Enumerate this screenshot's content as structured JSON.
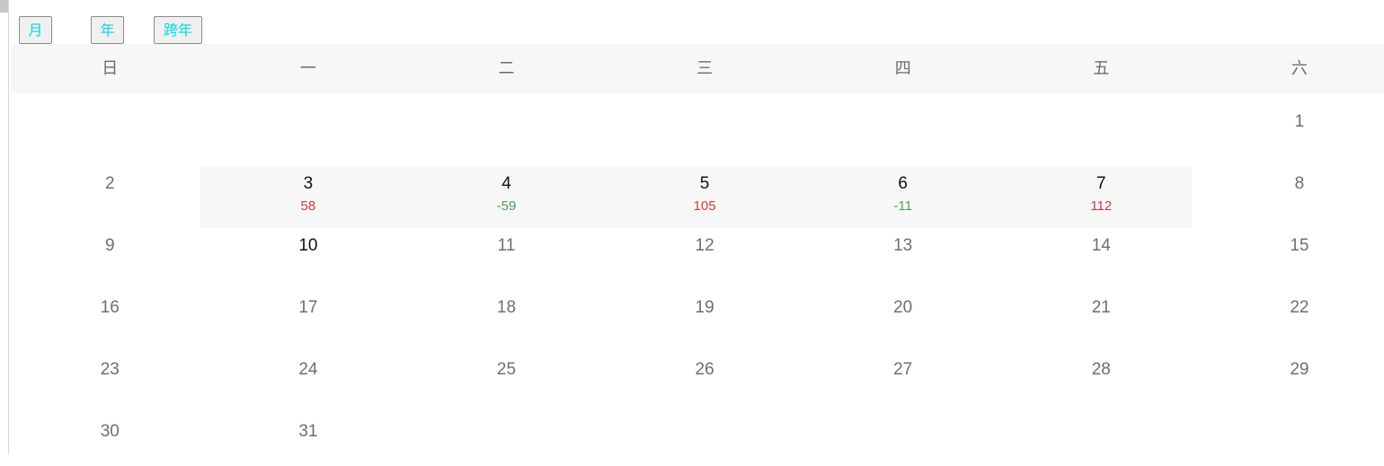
{
  "toolbar": {
    "month_label": "月",
    "year_label": "年",
    "cross_year_label": "跨年"
  },
  "weekdays": [
    "日",
    "一",
    "二",
    "三",
    "四",
    "五",
    "六"
  ],
  "weeks": [
    [
      null,
      null,
      null,
      null,
      null,
      null,
      {
        "day": "1"
      }
    ],
    [
      {
        "day": "2"
      },
      {
        "day": "3",
        "value": "58",
        "trend": "up",
        "active": true
      },
      {
        "day": "4",
        "value": "-59",
        "trend": "down",
        "active": true
      },
      {
        "day": "5",
        "value": "105",
        "trend": "up",
        "active": true
      },
      {
        "day": "6",
        "value": "-11",
        "trend": "down",
        "active": true
      },
      {
        "day": "7",
        "value": "112",
        "trend": "up",
        "active": true
      },
      {
        "day": "8"
      }
    ],
    [
      {
        "day": "9"
      },
      {
        "day": "10",
        "active": true
      },
      {
        "day": "11"
      },
      {
        "day": "12"
      },
      {
        "day": "13"
      },
      {
        "day": "14"
      },
      {
        "day": "15"
      }
    ],
    [
      {
        "day": "16"
      },
      {
        "day": "17"
      },
      {
        "day": "18"
      },
      {
        "day": "19"
      },
      {
        "day": "20"
      },
      {
        "day": "21"
      },
      {
        "day": "22"
      }
    ],
    [
      {
        "day": "23"
      },
      {
        "day": "24"
      },
      {
        "day": "25"
      },
      {
        "day": "26"
      },
      {
        "day": "27"
      },
      {
        "day": "28"
      },
      {
        "day": "29"
      }
    ],
    [
      {
        "day": "30"
      },
      {
        "day": "31"
      },
      null,
      null,
      null,
      null,
      null
    ]
  ],
  "colors": {
    "button_text": "#00d8e8",
    "positive": "#d23a3a",
    "negative": "#4aa05a",
    "highlight_bg": "#f7f7f7"
  }
}
